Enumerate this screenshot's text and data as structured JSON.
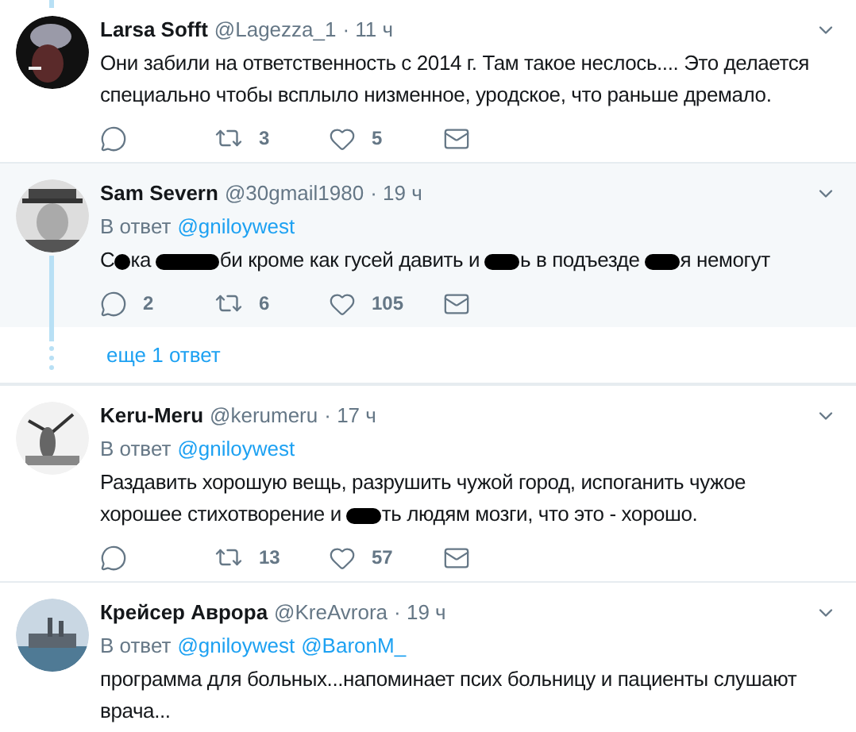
{
  "tweets": [
    {
      "name": "Larsa Sofft",
      "handle": "@Lagezza_1",
      "time": "· 11 ч",
      "thread": false,
      "body": [
        {
          "kind": "text",
          "text": "Они забили на ответственность с 2014 г. Там такое неслось.... Это делается специально чтобы всплыло низменное, уродское, что раньше дремало."
        }
      ],
      "actions": {
        "retweets": "3",
        "likes": "5"
      }
    },
    {
      "name": "Sam Severn",
      "handle": "@30gmail1980",
      "time": "· 19 ч",
      "thread": true,
      "reply_label": "В ответ",
      "reply_to": [
        "@gniloywest"
      ],
      "body": [
        {
          "kind": "text",
          "text": "С"
        },
        {
          "kind": "redaction_s"
        },
        {
          "kind": "text",
          "text": "ка "
        },
        {
          "kind": "redaction_l"
        },
        {
          "kind": "text",
          "text": "би кроме как гусей давить и "
        },
        {
          "kind": "redaction_m"
        },
        {
          "kind": "text",
          "text": "ь в подъезде "
        },
        {
          "kind": "redaction_m"
        },
        {
          "kind": "text",
          "text": "я немогут"
        }
      ],
      "actions": {
        "replies": "2",
        "retweets": "6",
        "likes": "105"
      }
    },
    {
      "kind": "more_link",
      "text": "еще 1 ответ"
    },
    {
      "name": "Keru-Meru",
      "handle": "@kerumeru",
      "time": "· 17 ч",
      "thread": false,
      "reply_label": "В ответ",
      "reply_to": [
        "@gniloywest"
      ],
      "body": [
        {
          "kind": "text",
          "text": "Раздавить хорошую вещь, разрушить чужой город, испоганить чужое хорошее стихотворение и "
        },
        {
          "kind": "redaction_m"
        },
        {
          "kind": "text",
          "text": "ть людям мозги, что это - хорошо."
        }
      ],
      "actions": {
        "retweets": "13",
        "likes": "57"
      }
    },
    {
      "name": "Крейсер Аврора",
      "handle": "@KreAvrora",
      "time": "· 19 ч",
      "thread": false,
      "reply_label": "В ответ",
      "reply_to": [
        "@gniloywest",
        "@BaronM_"
      ],
      "body": [
        {
          "kind": "text",
          "text": "программа для больных...напоминает псих больницу и пациенты слушают врача..."
        }
      ]
    }
  ]
}
